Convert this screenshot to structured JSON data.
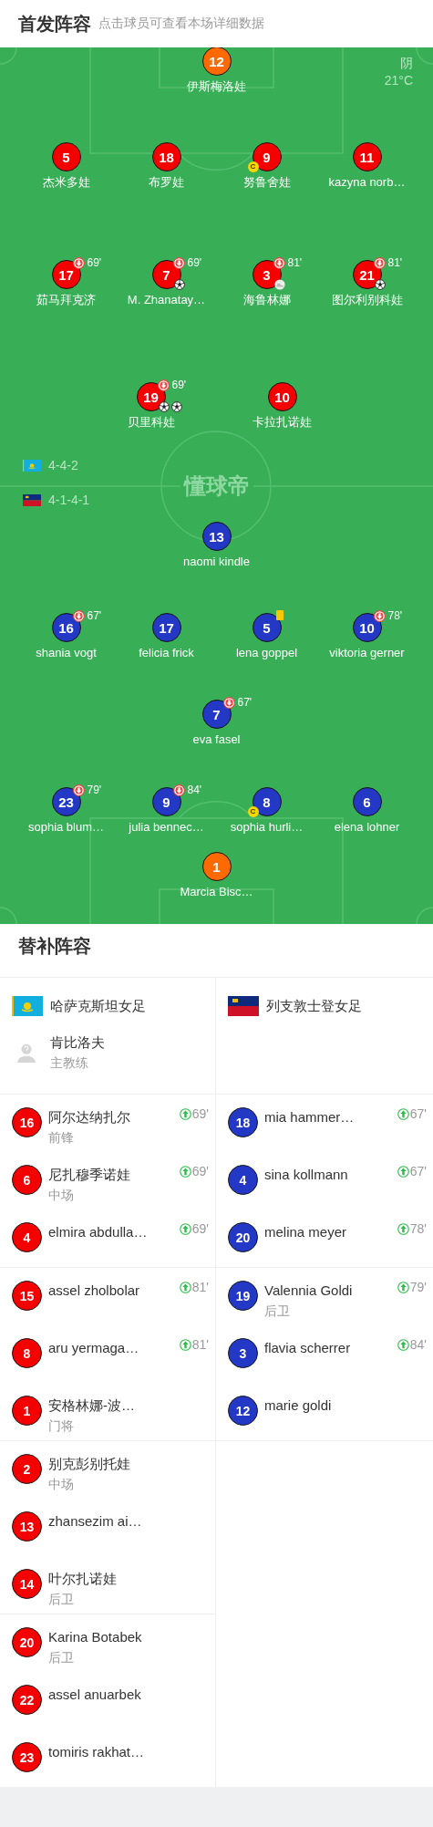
{
  "header": {
    "title": "首发阵容",
    "subtitle": "点击球员可查看本场详细数据"
  },
  "pitch": {
    "weather": "阴",
    "temperature": "21°C",
    "logo": "懂球帝",
    "teams": [
      {
        "formation": "4-4-2",
        "rows": [
          {
            "players": [
              {
                "number": "12",
                "name": "伊斯梅洛娃",
                "color": "#ff6a00"
              }
            ]
          },
          {
            "players": [
              {
                "number": "5",
                "name": "杰米多娃",
                "color": "#f40000"
              },
              {
                "number": "18",
                "name": "布罗娃",
                "color": "#f40000"
              },
              {
                "number": "9",
                "name": "努鲁舍娃",
                "color": "#f40000",
                "events": [
                  {
                    "kind": "captain",
                    "label": "C"
                  }
                ]
              },
              {
                "number": "11",
                "name": "kazyna norb…",
                "color": "#f40000"
              }
            ]
          },
          {
            "players": [
              {
                "number": "17",
                "name": "茹马拜克济",
                "color": "#f40000",
                "events": [
                  {
                    "kind": "sub_off",
                    "minute": "69'"
                  }
                ]
              },
              {
                "number": "7",
                "name": "M. Zhanatay…",
                "color": "#f40000",
                "events": [
                  {
                    "kind": "sub_off",
                    "minute": "69'"
                  },
                  {
                    "kind": "goal"
                  }
                ]
              },
              {
                "number": "3",
                "name": "海鲁林娜",
                "color": "#f40000",
                "events": [
                  {
                    "kind": "sub_off",
                    "minute": "81'"
                  },
                  {
                    "kind": "assist"
                  }
                ]
              },
              {
                "number": "21",
                "name": "图尔利别科娃",
                "color": "#f40000",
                "events": [
                  {
                    "kind": "sub_off",
                    "minute": "81'"
                  },
                  {
                    "kind": "goal"
                  }
                ]
              }
            ]
          },
          {
            "players": [
              {
                "number": "19",
                "name": "贝里科娃",
                "color": "#f40000",
                "events": [
                  {
                    "kind": "sub_off",
                    "minute": "69'"
                  },
                  {
                    "kind": "goal"
                  },
                  {
                    "kind": "goal"
                  }
                ]
              },
              {
                "number": "10",
                "name": "卡拉扎诺娃",
                "color": "#f40000"
              }
            ]
          }
        ]
      },
      {
        "formation": "4-1-4-1",
        "rows": [
          {
            "players": [
              {
                "number": "13",
                "name": "naomi kindle",
                "color": "#2338c4"
              }
            ]
          },
          {
            "players": [
              {
                "number": "16",
                "name": "shania vogt",
                "color": "#2338c4",
                "events": [
                  {
                    "kind": "sub_off",
                    "minute": "67'"
                  }
                ]
              },
              {
                "number": "17",
                "name": "felicia frick",
                "color": "#2338c4"
              },
              {
                "number": "5",
                "name": "lena goppel",
                "color": "#2338c4",
                "events": [
                  {
                    "kind": "yellow_card"
                  }
                ]
              },
              {
                "number": "10",
                "name": "viktoria gerner",
                "color": "#2338c4",
                "events": [
                  {
                    "kind": "sub_off",
                    "minute": "78'"
                  }
                ]
              }
            ]
          },
          {
            "players": [
              {
                "number": "7",
                "name": "eva fasel",
                "color": "#2338c4",
                "events": [
                  {
                    "kind": "sub_off",
                    "minute": "67'"
                  }
                ]
              }
            ]
          },
          {
            "players": [
              {
                "number": "23",
                "name": "sophia blum…",
                "color": "#2338c4",
                "events": [
                  {
                    "kind": "sub_off",
                    "minute": "79'"
                  }
                ]
              },
              {
                "number": "9",
                "name": "julia bennec…",
                "color": "#2338c4",
                "events": [
                  {
                    "kind": "sub_off",
                    "minute": "84'"
                  }
                ]
              },
              {
                "number": "8",
                "name": "sophia hurli…",
                "color": "#2338c4",
                "events": [
                  {
                    "kind": "captain",
                    "label": "C"
                  }
                ]
              },
              {
                "number": "6",
                "name": "elena lohner",
                "color": "#2338c4"
              }
            ]
          },
          {
            "players": [
              {
                "number": "1",
                "name": "Marcia Bisc…",
                "color": "#ff6a00"
              }
            ]
          }
        ]
      }
    ]
  },
  "bench": {
    "title": "替补阵容",
    "teams": [
      {
        "name": "哈萨克斯坦女足",
        "color": "#f40000",
        "coach": {
          "name": "肯比洛夫",
          "role": "主教练"
        },
        "groups": [
          [
            {
              "number": "16",
              "name": "阿尔达纳扎尔",
              "position": "前锋",
              "sub_in": "69'"
            },
            {
              "number": "6",
              "name": "尼扎穆季诺娃",
              "position": "中场",
              "sub_in": "69'"
            },
            {
              "number": "4",
              "name": "elmira abdulla…",
              "sub_in": "69'"
            }
          ],
          [
            {
              "number": "15",
              "name": "assel zholbolar",
              "sub_in": "81'"
            },
            {
              "number": "8",
              "name": "aru yermaga…",
              "sub_in": "81'"
            },
            {
              "number": "1",
              "name": "安格林娜-波…",
              "position": "门将"
            }
          ],
          [
            {
              "number": "2",
              "name": "别克彭别托娃",
              "position": "中场"
            },
            {
              "number": "13",
              "name": "zhansezim ai…"
            },
            {
              "number": "14",
              "name": "叶尔扎诺娃",
              "position": "后卫"
            }
          ],
          [
            {
              "number": "20",
              "name": "Karina Botabek",
              "position": "后卫"
            },
            {
              "number": "22",
              "name": "assel anuarbek"
            },
            {
              "number": "23",
              "name": "tomiris rakhat…"
            }
          ]
        ]
      },
      {
        "name": "列支敦士登女足",
        "color": "#2338c4",
        "groups": [
          [
            {
              "number": "18",
              "name": "mia hammer…",
              "sub_in": "67'"
            },
            {
              "number": "4",
              "name": "sina kollmann",
              "sub_in": "67'"
            },
            {
              "number": "20",
              "name": "melina meyer",
              "sub_in": "78'"
            }
          ],
          [
            {
              "number": "19",
              "name": "Valennia Goldi",
              "position": "后卫",
              "sub_in": "79'"
            },
            {
              "number": "3",
              "name": "flavia scherrer",
              "sub_in": "84'"
            },
            {
              "number": "12",
              "name": "marie goldi"
            }
          ]
        ]
      }
    ]
  }
}
